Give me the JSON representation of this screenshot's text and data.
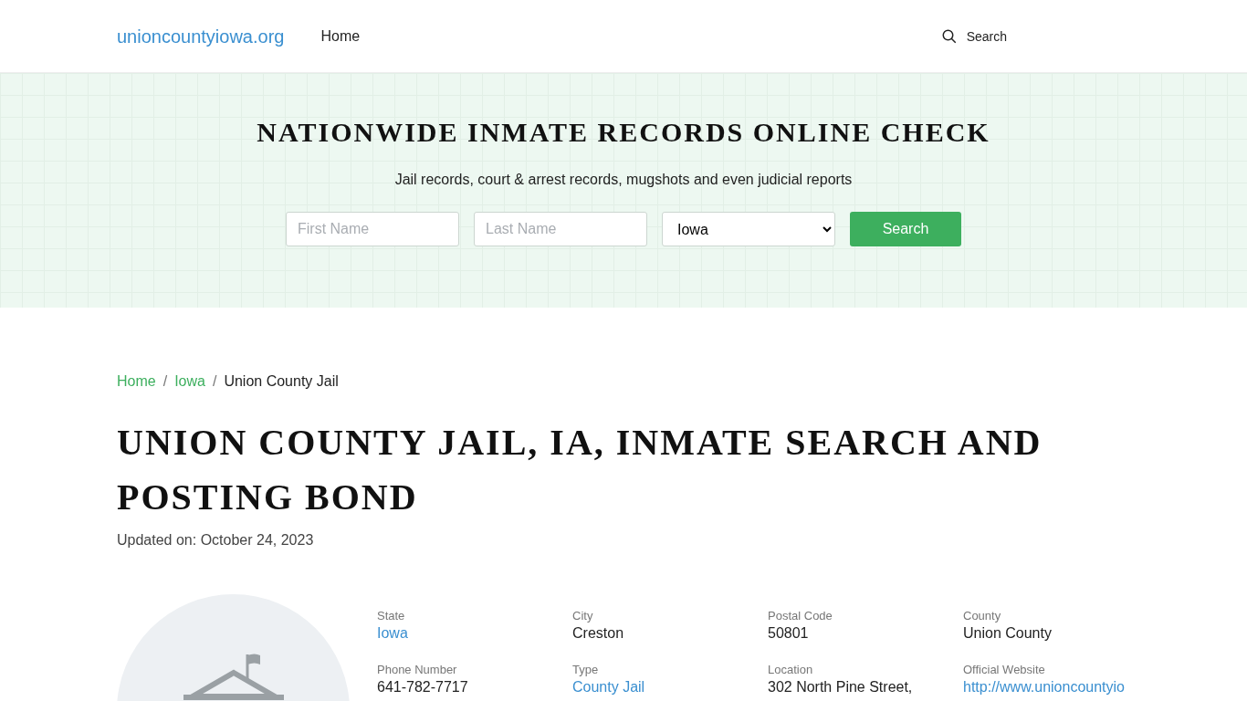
{
  "header": {
    "logo": "unioncountyiowa.org",
    "nav": [
      {
        "label": "Home"
      }
    ],
    "search": {
      "label": "Search"
    }
  },
  "hero": {
    "title": "NATIONWIDE INMATE RECORDS ONLINE CHECK",
    "subtitle": "Jail records, court & arrest records, mugshots and even judicial reports",
    "first_name": {
      "placeholder": "First Name"
    },
    "last_name": {
      "placeholder": "Last Name"
    },
    "state_select": {
      "value": "Iowa"
    },
    "button": "Search"
  },
  "breadcrumb": [
    {
      "label": "Home",
      "kind": "link"
    },
    {
      "label": "Iowa",
      "kind": "link",
      "separator": "/"
    },
    {
      "label": "Union County Jail",
      "kind": "current",
      "separator": "/"
    }
  ],
  "page_title": "UNION COUNTY JAIL, IA, INMATE SEARCH AND POSTING BOND",
  "updated": {
    "label": "Updated on:",
    "date": "October 24, 2023"
  },
  "details": [
    {
      "label": "State",
      "value": "Iowa",
      "kind": "link"
    },
    {
      "label": "City",
      "value": "Creston",
      "kind": "text"
    },
    {
      "label": "Postal Code",
      "value": "50801",
      "kind": "text"
    },
    {
      "label": "County",
      "value": "Union County",
      "kind": "text"
    },
    {
      "label": "Phone Number",
      "value": "641-782-7717",
      "kind": "text"
    },
    {
      "label": "Type",
      "value": "County Jail",
      "kind": "link"
    },
    {
      "label": "Location",
      "value": "302 North Pine Street,",
      "kind": "text"
    },
    {
      "label": "Official Website",
      "value": "http://www.unioncountyio",
      "kind": "link"
    }
  ]
}
